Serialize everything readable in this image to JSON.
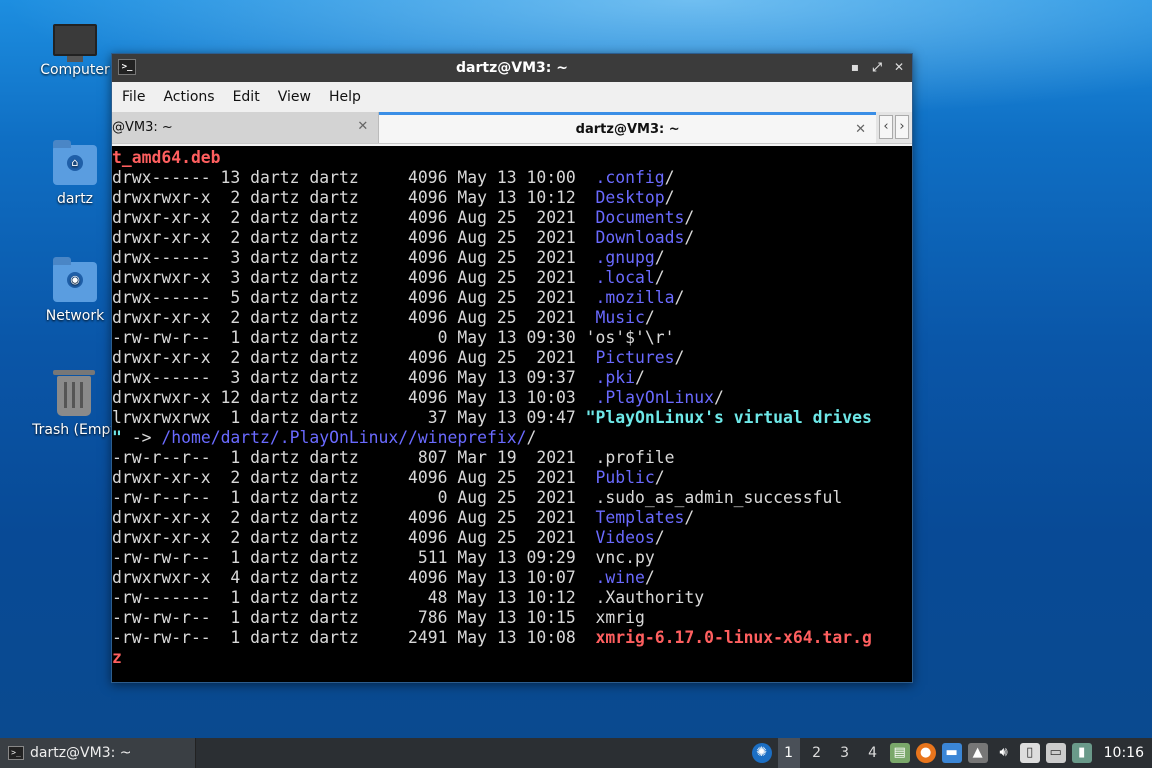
{
  "desktop": {
    "icons": [
      {
        "label": "Computer"
      },
      {
        "label": "dartz"
      },
      {
        "label": "Network"
      },
      {
        "label": "Trash (Empt"
      }
    ]
  },
  "window": {
    "title": "dartz@VM3: ~",
    "menu": [
      "File",
      "Actions",
      "Edit",
      "View",
      "Help"
    ],
    "tabs": [
      {
        "label": "@VM3: ~",
        "active": false
      },
      {
        "label": "dartz@VM3: ~",
        "active": true
      }
    ],
    "close_glyph": "✕",
    "nav_left": "‹",
    "nav_right": "›"
  },
  "terminal": {
    "lines": [
      {
        "text": "",
        "name": "t_amd64.deb",
        "style": "red"
      },
      {
        "text": "drwx------ 13 dartz dartz     4096 May 13 10:00  ",
        "name": ".config",
        "style": "dir",
        "suffix": "/"
      },
      {
        "text": "drwxrwxr-x  2 dartz dartz     4096 May 13 10:12  ",
        "name": "Desktop",
        "style": "dir",
        "suffix": "/"
      },
      {
        "text": "drwxr-xr-x  2 dartz dartz     4096 Aug 25  2021  ",
        "name": "Documents",
        "style": "dir",
        "suffix": "/"
      },
      {
        "text": "drwxr-xr-x  2 dartz dartz     4096 Aug 25  2021  ",
        "name": "Downloads",
        "style": "dir",
        "suffix": "/"
      },
      {
        "text": "drwx------  3 dartz dartz     4096 Aug 25  2021  ",
        "name": ".gnupg",
        "style": "dir",
        "suffix": "/"
      },
      {
        "text": "drwxrwxr-x  3 dartz dartz     4096 Aug 25  2021  ",
        "name": ".local",
        "style": "dir",
        "suffix": "/"
      },
      {
        "text": "drwx------  5 dartz dartz     4096 Aug 25  2021  ",
        "name": ".mozilla",
        "style": "dir",
        "suffix": "/"
      },
      {
        "text": "drwxr-xr-x  2 dartz dartz     4096 Aug 25  2021  ",
        "name": "Music",
        "style": "dir",
        "suffix": "/"
      },
      {
        "text": "-rw-rw-r--  1 dartz dartz        0 May 13 09:30 ",
        "name": "'os'$'\\r'",
        "style": "plain",
        "suffix": ""
      },
      {
        "text": "drwxr-xr-x  2 dartz dartz     4096 Aug 25  2021  ",
        "name": "Pictures",
        "style": "dir",
        "suffix": "/"
      },
      {
        "text": "drwx------  3 dartz dartz     4096 May 13 09:37  ",
        "name": ".pki",
        "style": "dir",
        "suffix": "/"
      },
      {
        "text": "drwxrwxr-x 12 dartz dartz     4096 May 13 10:03  ",
        "name": ".PlayOnLinux",
        "style": "dir",
        "suffix": "/"
      },
      {
        "text": "lrwxrwxrwx  1 dartz dartz       37 May 13 09:47 ",
        "name": "\"PlayOnLinux's virtual drives",
        "style": "cyan",
        "suffix": ""
      },
      {
        "text": "",
        "name": "\"",
        "style": "cyan",
        "suffix": " -> ",
        "target": "/home/dartz/.PlayOnLinux//wineprefix/",
        "target_suffix": "/"
      },
      {
        "text": "-rw-r--r--  1 dartz dartz      807 Mar 19  2021  .profile",
        "name": "",
        "style": "plain",
        "suffix": ""
      },
      {
        "text": "drwxr-xr-x  2 dartz dartz     4096 Aug 25  2021  ",
        "name": "Public",
        "style": "dir",
        "suffix": "/"
      },
      {
        "text": "-rw-r--r--  1 dartz dartz        0 Aug 25  2021  .sudo_as_admin_successful",
        "name": "",
        "style": "plain",
        "suffix": ""
      },
      {
        "text": "drwxr-xr-x  2 dartz dartz     4096 Aug 25  2021  ",
        "name": "Templates",
        "style": "dir",
        "suffix": "/"
      },
      {
        "text": "drwxr-xr-x  2 dartz dartz     4096 Aug 25  2021  ",
        "name": "Videos",
        "style": "dir",
        "suffix": "/"
      },
      {
        "text": "-rw-rw-r--  1 dartz dartz      511 May 13 09:29  vnc.py",
        "name": "",
        "style": "plain",
        "suffix": ""
      },
      {
        "text": "drwxrwxr-x  4 dartz dartz     4096 May 13 10:07  ",
        "name": ".wine",
        "style": "dir",
        "suffix": "/"
      },
      {
        "text": "-rw-------  1 dartz dartz       48 May 13 10:12  .Xauthority",
        "name": "",
        "style": "plain",
        "suffix": ""
      },
      {
        "text": "-rw-rw-r--  1 dartz dartz      786 May 13 10:15  xmrig",
        "name": "",
        "style": "plain",
        "suffix": ""
      },
      {
        "text": "-rw-rw-r--  1 dartz dartz     2491 May 13 10:08  ",
        "name": "xmrig-6.17.0-linux-x64.tar.g",
        "style": "red",
        "suffix": ""
      },
      {
        "text": "",
        "name": "z",
        "style": "red",
        "suffix": ""
      }
    ]
  },
  "taskbar": {
    "task_label": "dartz@VM3: ~",
    "workspaces": [
      "1",
      "2",
      "3",
      "4"
    ],
    "active_workspace": "1",
    "clock": "10:16",
    "tray_icons": [
      "xubuntu-icon",
      "workspace-pager",
      "notes-icon",
      "firefox-icon",
      "folder-icon",
      "updates-icon",
      "volume-icon",
      "clipboard-icon",
      "network-icon",
      "battery-icon"
    ]
  },
  "colors": {
    "dir": "#6a6aff",
    "exec_red": "#ff5f5f",
    "link_cyan": "#6ee8e8",
    "accent": "#3a8ee6"
  }
}
